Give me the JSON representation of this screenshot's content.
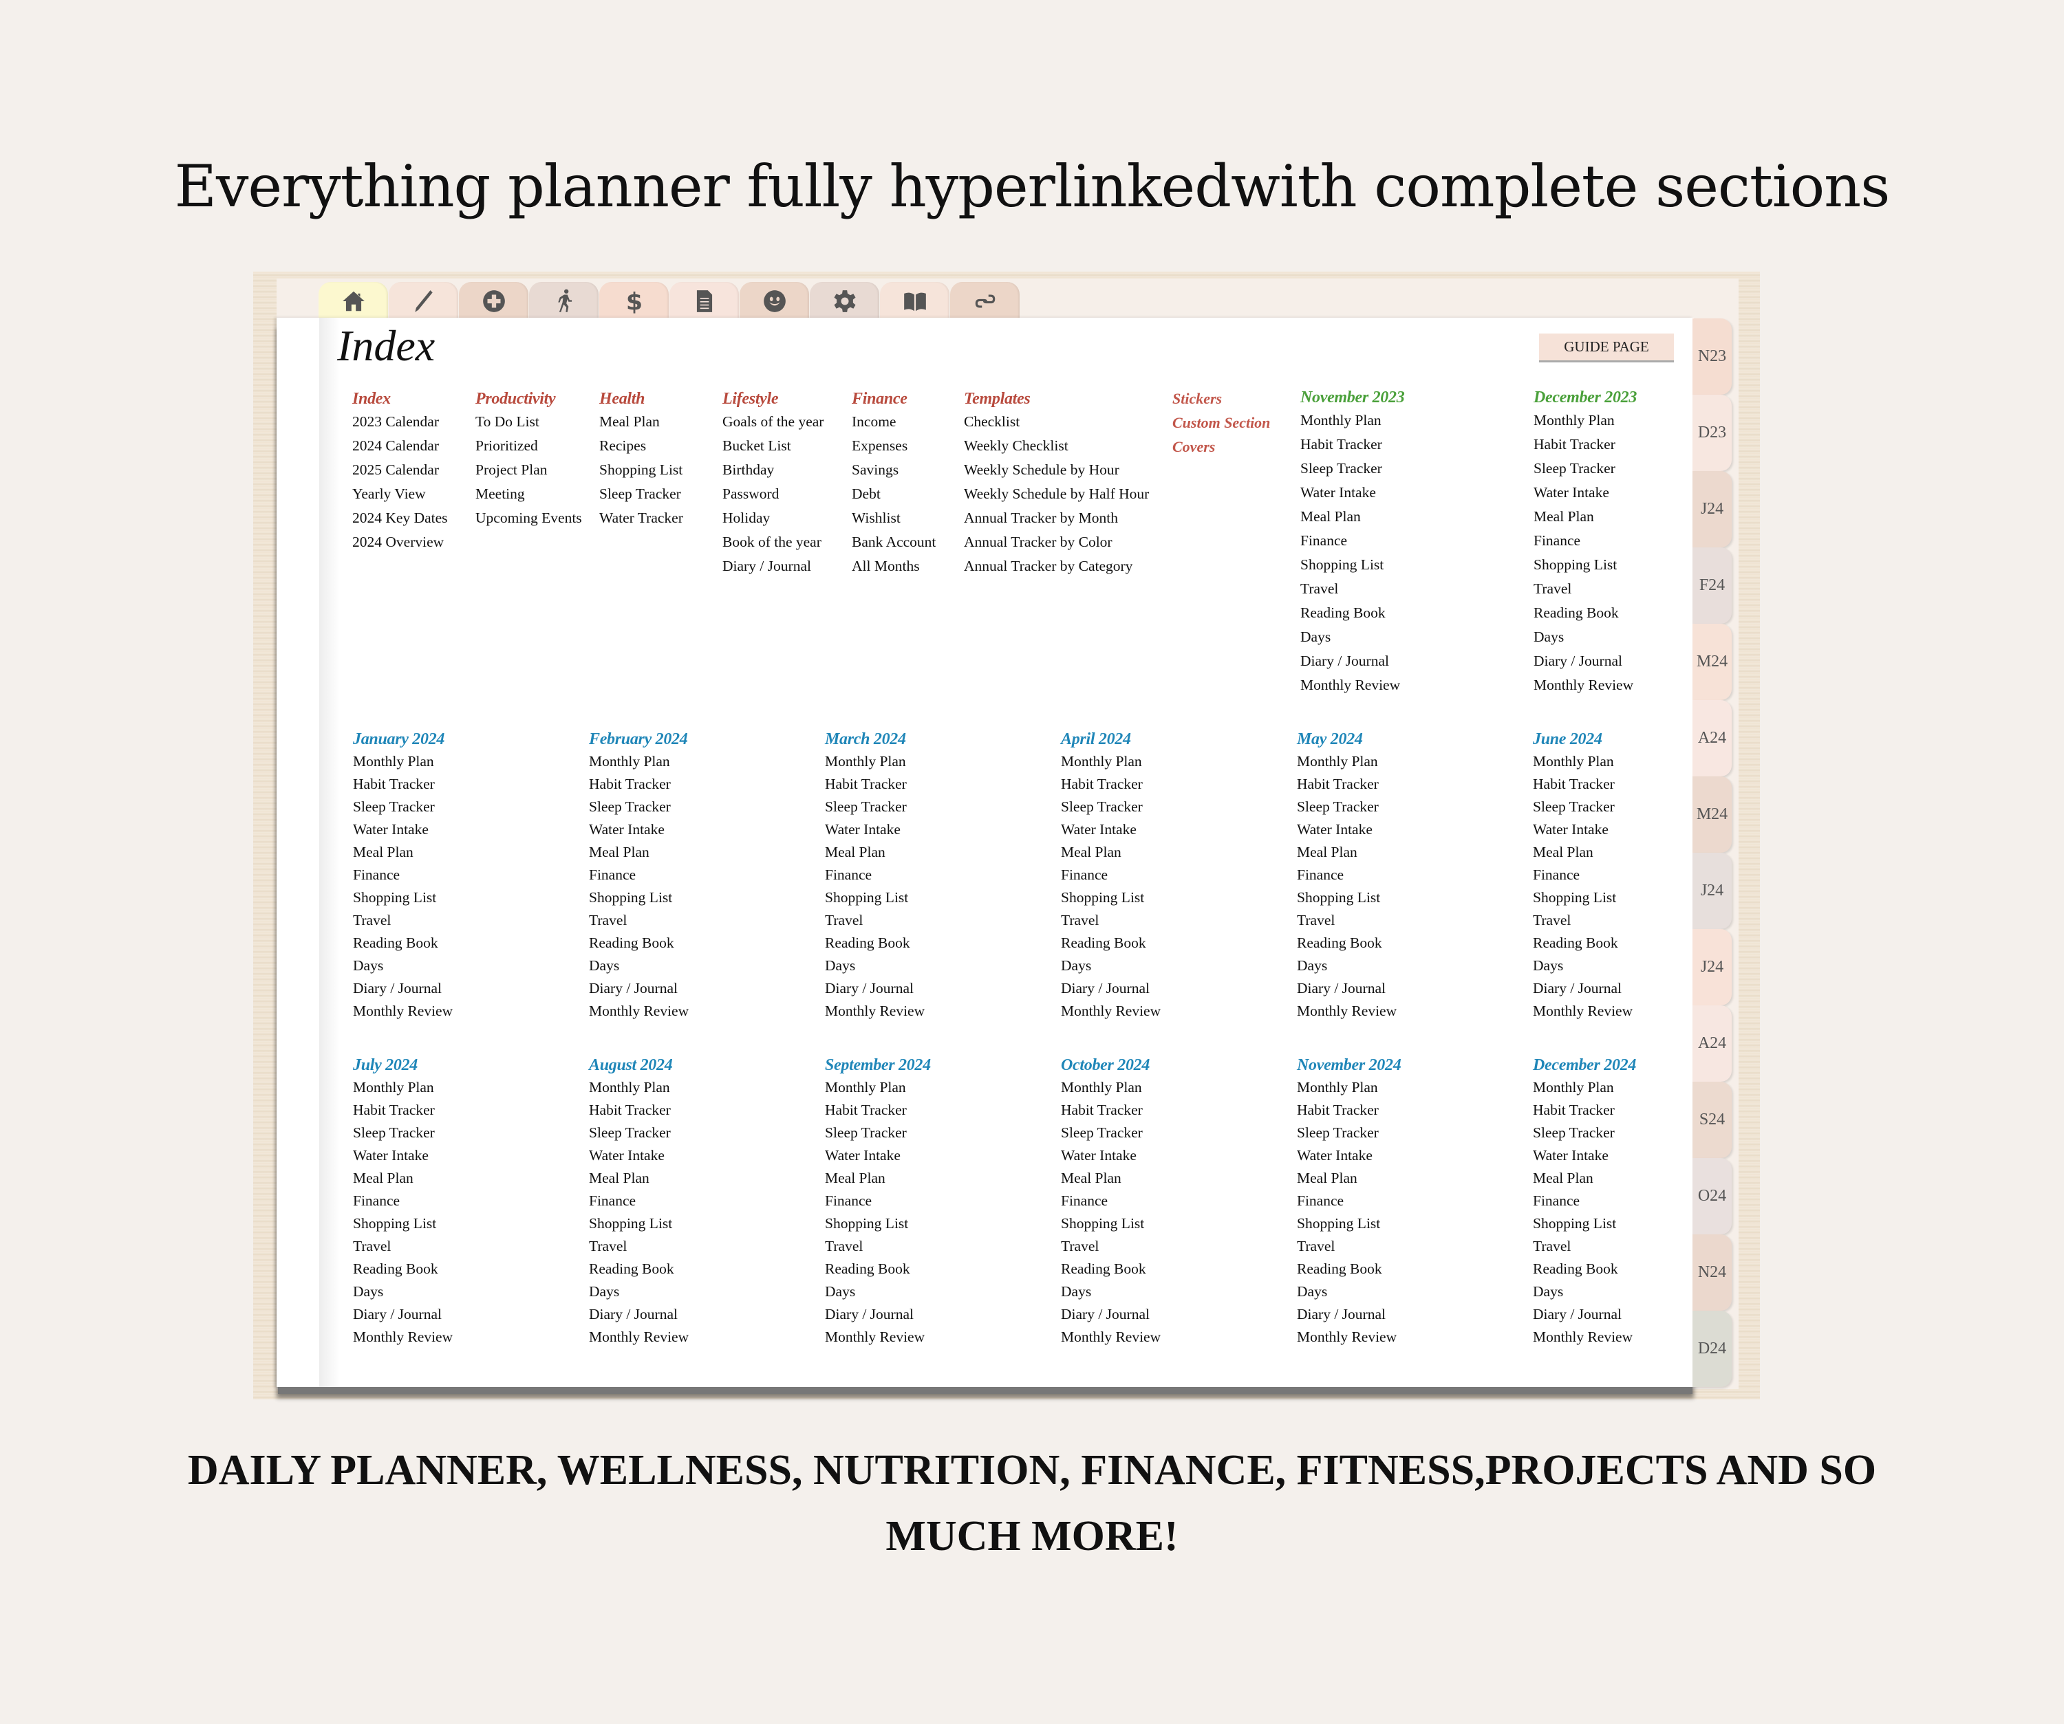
{
  "headline": "Everything planner fully hyperlinkedwith complete sections",
  "footer": "DAILY PLANNER, WELLNESS, NUTRITION, FINANCE, FITNESS,PROJECTS AND SO MUCH MORE!",
  "top_tabs": [
    {
      "icon": "home-icon",
      "color": "#fcf8cf"
    },
    {
      "icon": "pencil-icon",
      "color": "#f6e4da"
    },
    {
      "icon": "health-cross-icon",
      "color": "#ecd6c8"
    },
    {
      "icon": "running-person-icon",
      "color": "#e8dad3"
    },
    {
      "icon": "dollar-icon",
      "color": "#f6dccf"
    },
    {
      "icon": "document-icon",
      "color": "#f7e4dc"
    },
    {
      "icon": "smiley-icon",
      "color": "#ecd6c8"
    },
    {
      "icon": "gear-icon",
      "color": "#e8dad3"
    },
    {
      "icon": "book-icon",
      "color": "#f6e4da"
    },
    {
      "icon": "link-icon",
      "color": "#ecd6c8"
    }
  ],
  "page": {
    "title": "Index",
    "guide_button": "GUIDE PAGE"
  },
  "sections": [
    {
      "header": "Index",
      "items": [
        "2023 Calendar",
        "2024 Calendar",
        "2025 Calendar",
        "Yearly View",
        "2024 Key Dates",
        "2024 Overview"
      ]
    },
    {
      "header": "Productivity",
      "items": [
        "To Do List",
        "Prioritized",
        "Project Plan",
        "Meeting",
        "Upcoming Events"
      ]
    },
    {
      "header": "Health",
      "items": [
        "Meal Plan",
        "Recipes",
        "Shopping List",
        "Sleep Tracker",
        "Water Tracker"
      ]
    },
    {
      "header": "Lifestyle",
      "items": [
        "Goals of the year",
        "Bucket List",
        "Birthday",
        "Password",
        "Holiday",
        "Book of the year",
        "Diary / Journal"
      ]
    },
    {
      "header": "Finance",
      "items": [
        "Income",
        "Expenses",
        "Savings",
        "Debt",
        "Wishlist",
        "Bank Account",
        "All Months"
      ]
    },
    {
      "header": "Templates",
      "items": [
        "Checklist",
        "Weekly Checklist",
        "Weekly Schedule by Hour",
        "Weekly Schedule by Half Hour",
        "Annual Tracker by Month",
        "Annual Tracker by Color",
        "Annual Tracker by Category"
      ]
    }
  ],
  "extra_links": [
    "Stickers",
    "Custom Section",
    "Covers"
  ],
  "month_items": [
    "Monthly Plan",
    "Habit Tracker",
    "Sleep Tracker",
    "Water Intake",
    "Meal Plan",
    "Finance",
    "Shopping List",
    "Travel",
    "Reading Book",
    "Days",
    "Diary / Journal",
    "Monthly Review"
  ],
  "months_2023": [
    "November 2023",
    "December 2023"
  ],
  "months_2024": [
    "January 2024",
    "February 2024",
    "March 2024",
    "April 2024",
    "May 2024",
    "June 2024",
    "July 2024",
    "August 2024",
    "September 2024",
    "October 2024",
    "November 2024",
    "December 2024"
  ],
  "side_tabs": [
    {
      "label": "N23",
      "color": "#f5ddd1"
    },
    {
      "label": "D23",
      "color": "#f7e7e0"
    },
    {
      "label": "J24",
      "color": "#ecd9ce"
    },
    {
      "label": "F24",
      "color": "#e8dedb"
    },
    {
      "label": "M24",
      "color": "#f7e2d7"
    },
    {
      "label": "A24",
      "color": "#f8e7e1"
    },
    {
      "label": "M24",
      "color": "#ecd9ce"
    },
    {
      "label": "J24",
      "color": "#e7dfdc"
    },
    {
      "label": "J24",
      "color": "#f8e2d8"
    },
    {
      "label": "A24",
      "color": "#f7e7e1"
    },
    {
      "label": "S24",
      "color": "#ecdacf"
    },
    {
      "label": "O24",
      "color": "#e9e0de"
    },
    {
      "label": "N24",
      "color": "#ebd8cd"
    },
    {
      "label": "D24",
      "color": "#dcdcd3"
    }
  ]
}
